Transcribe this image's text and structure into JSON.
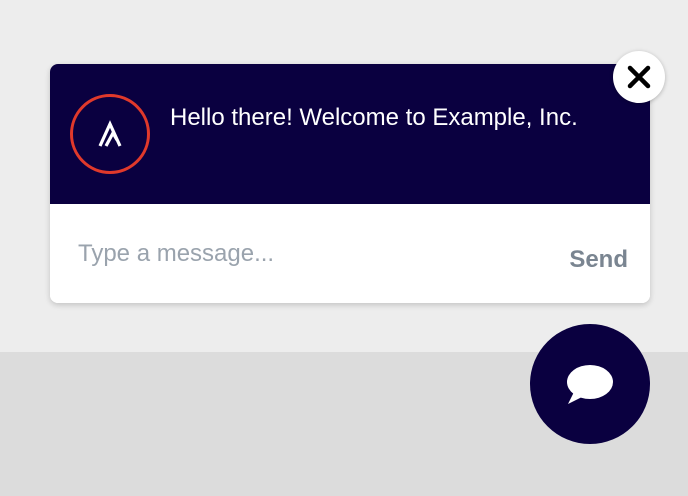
{
  "chat_widget": {
    "welcome_message": "Hello there! Welcome to Example, Inc.",
    "input_placeholder": "Type a message...",
    "input_value": "",
    "send_label": "Send"
  },
  "icons": {
    "close": "close-icon",
    "launcher": "chat-bubble-icon",
    "avatar_logo": "logo-icon"
  },
  "colors": {
    "header_background": "#0a0040",
    "avatar_ring": "#e0392b",
    "page_background_top": "#ededed",
    "page_background_bottom": "#dcdcdc",
    "send_text": "#7a8591",
    "placeholder_text": "#9aa3ad"
  }
}
